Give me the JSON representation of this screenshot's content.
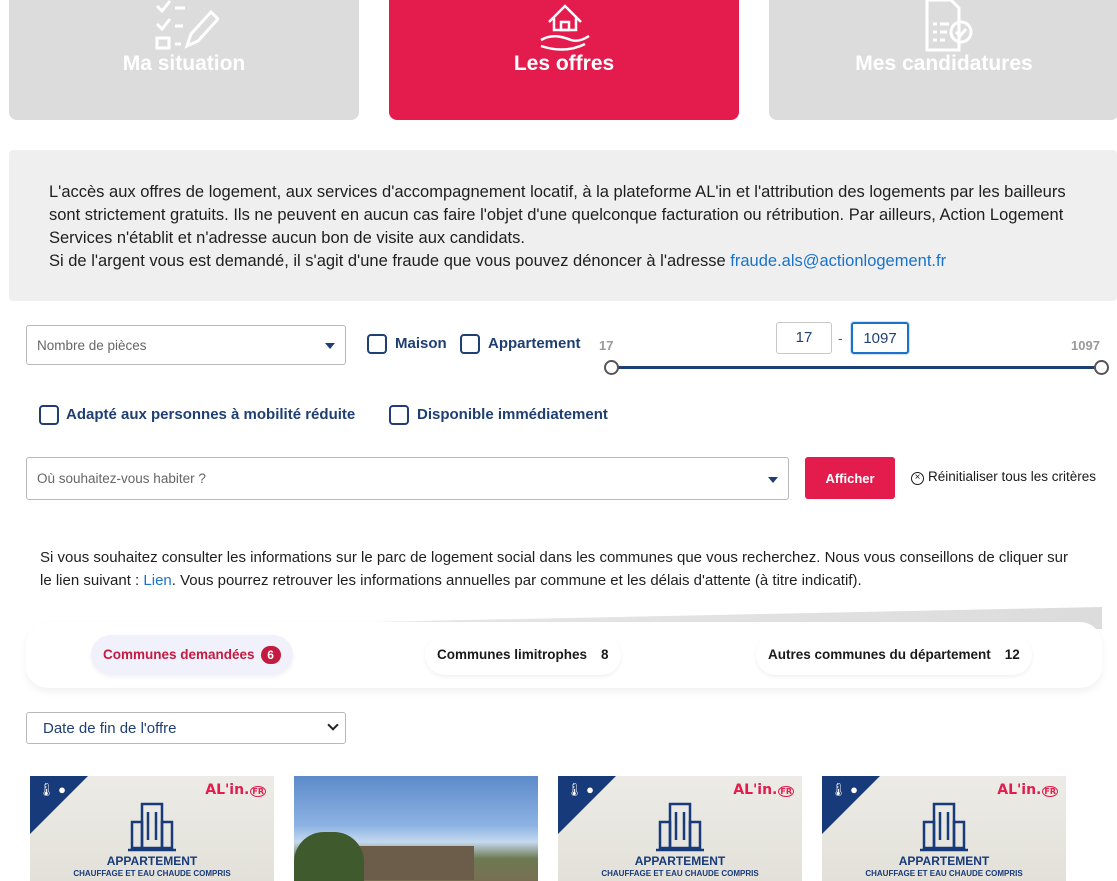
{
  "tabs": [
    {
      "label": "Ma situation",
      "icon": "checklist-pencil-icon",
      "active": false
    },
    {
      "label": "Les offres",
      "icon": "house-hand-icon",
      "active": true
    },
    {
      "label": "Mes candidatures",
      "icon": "document-check-icon",
      "active": false
    }
  ],
  "notice": {
    "text": "L'accès aux offres de logement, aux services d'accompagnement locatif, à la plateforme AL'in et l'attribution des logements par les bailleurs sont strictement gratuits. Ils ne peuvent en aucun cas faire l'objet d'une quelconque facturation ou rétribution. Par ailleurs, Action Logement Services n'établit et n'adresse aucun bon de visite aux candidats.",
    "fraud_text": "Si de l'argent vous est demandé, il s'agit d'une fraude que vous pouvez dénoncer à l'adresse",
    "email": "fraude.als@actionlogement.fr"
  },
  "filters": {
    "rooms_placeholder": "Nombre de pièces",
    "maison_label": "Maison",
    "appartement_label": "Appartement",
    "range_min_label": "17",
    "range_max_label": "1097",
    "range_min_value": "17",
    "range_separator": "-",
    "range_max_value": "1097",
    "pmr_label": "Adapté aux personnes à mobilité réduite",
    "dispo_label": "Disponible immédiatement",
    "location_placeholder": "Où souhaitez-vous habiter ?",
    "submit_label": "Afficher",
    "reset_label": "Réinitialiser tous les critères"
  },
  "info": {
    "text_before": "Si vous souhaitez consulter les informations sur le parc de logement social dans les communes que vous recherchez. Nous vous conseillons de cliquer sur le lien suivant : ",
    "link": "Lien",
    "text_after": ". Vous pourrez retrouver les informations annuelles par commune et les délais d'attente (à titre indicatif)."
  },
  "commune_tabs": [
    {
      "label": "Communes demandées",
      "count": "6",
      "active": true
    },
    {
      "label": "Communes limitrophes",
      "count": "8",
      "active": false
    },
    {
      "label": "Autres communes du département",
      "count": "12",
      "active": false
    }
  ],
  "sort": {
    "selected": "Date de fin de l'offre"
  },
  "cards": [
    {
      "type": "placeholder",
      "brand": "AL'in.",
      "brand_badge": "FR",
      "title": "APPARTEMENT",
      "subtitle": "CHAUFFAGE ET EAU CHAUDE COMPRIS"
    },
    {
      "type": "photo"
    },
    {
      "type": "placeholder",
      "brand": "AL'in.",
      "brand_badge": "FR",
      "title": "APPARTEMENT",
      "subtitle": "CHAUFFAGE ET EAU CHAUDE COMPRIS"
    },
    {
      "type": "placeholder",
      "brand": "AL'in.",
      "brand_badge": "FR",
      "title": "APPARTEMENT",
      "subtitle": "CHAUFFAGE ET EAU CHAUDE COMPRIS"
    }
  ],
  "colors": {
    "accent": "#e41c4d",
    "navy": "#1f3f73",
    "link": "#1a73c8"
  }
}
